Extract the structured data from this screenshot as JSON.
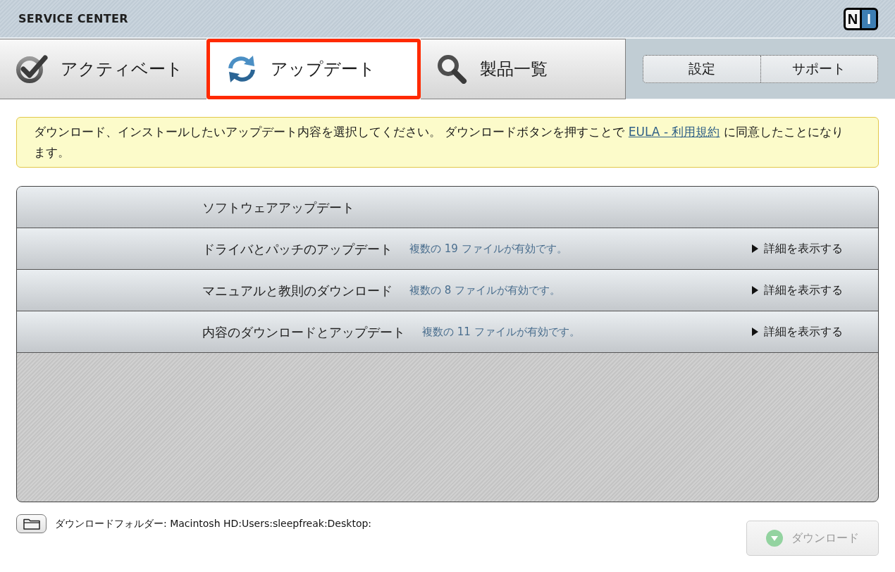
{
  "header": {
    "title": "SERVICE CENTER",
    "logo": [
      "N",
      "I"
    ]
  },
  "tabs": [
    {
      "label": "アクティベート",
      "selected": false,
      "highlighted": false
    },
    {
      "label": "アップデート",
      "selected": true,
      "highlighted": true
    },
    {
      "label": "製品一覧",
      "selected": false,
      "highlighted": false
    }
  ],
  "top_buttons": [
    "設定",
    "サポート"
  ],
  "notice": {
    "before": "ダウンロード、インストールしたいアップデート内容を選択してください。 ダウンロードボタンを押すことで ",
    "link": "EULA - 利用規約",
    "after": " に同意したことになります。"
  },
  "updates": {
    "title": "ソフトウェアアップデート",
    "rows": [
      {
        "title": "ドライバとパッチのアップデート",
        "count": "複数の 19 ファイルが有効です。",
        "details": "詳細を表示する",
        "expanded": false
      },
      {
        "title": "マニュアルと教則のダウンロード",
        "count": "複数の 8 ファイルが有効です。",
        "details": "詳細を表示する",
        "expanded": false
      },
      {
        "title": "内容のダウンロードとアップデート",
        "count": "複数の 11 ファイルが有効です。",
        "details": "詳細を表示する",
        "expanded": false
      }
    ]
  },
  "download_folder": {
    "label": "ダウンロードフォルダー: Macintosh HD:Users:sleepfreak:Desktop:"
  },
  "download_button": {
    "label": "ダウンロード",
    "disabled": true
  }
}
